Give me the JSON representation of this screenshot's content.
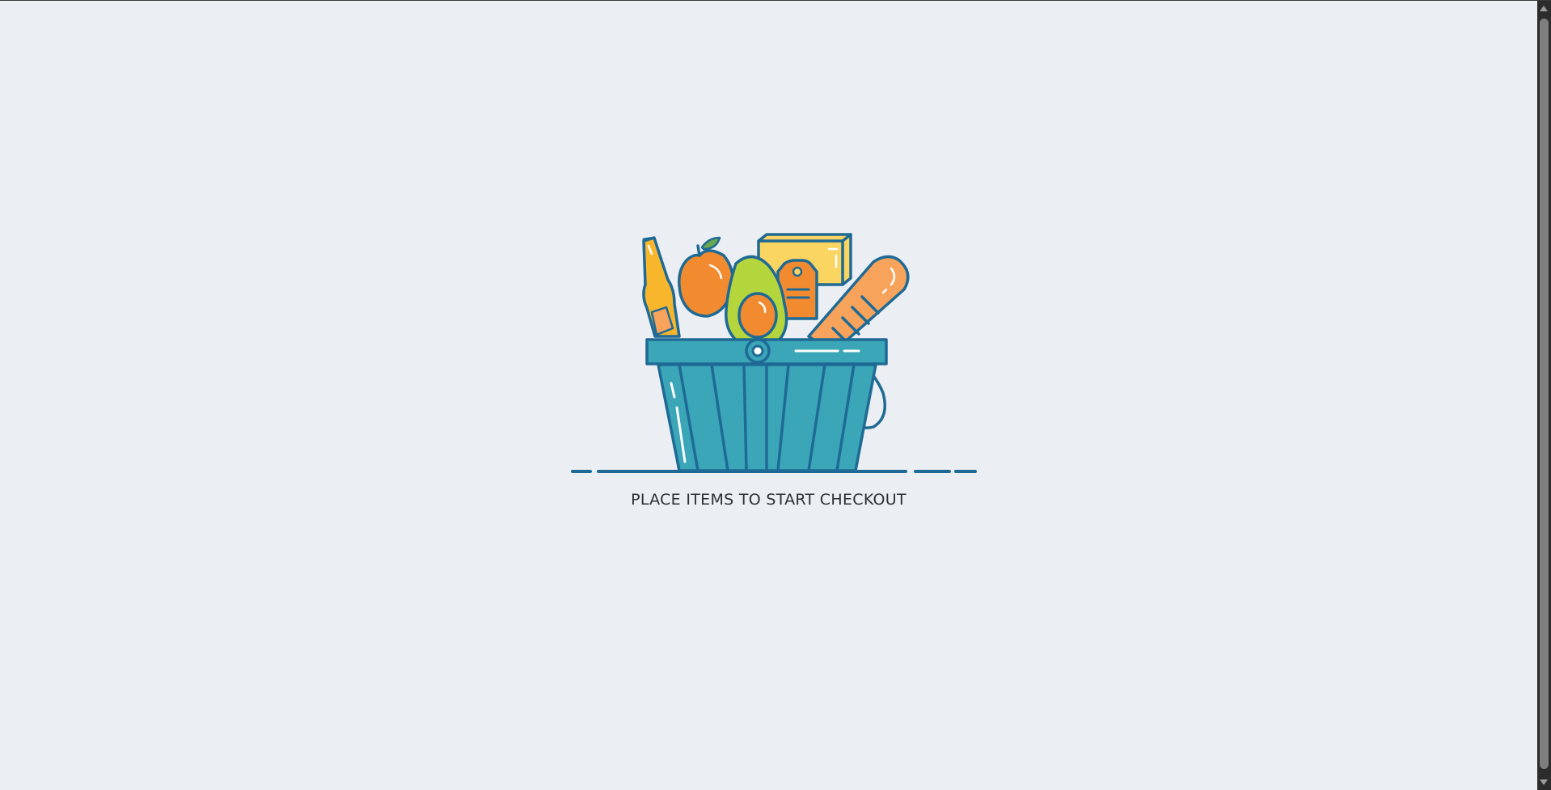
{
  "checkout": {
    "message": "PLACE ITEMS TO START CHECKOUT",
    "illustration": "grocery-basket-illustration"
  },
  "colors": {
    "background": "#ebeff3",
    "outline": "#1f6a95",
    "basket": "#3aa6b8",
    "orange": "#f28a30",
    "bread": "#f7a35c",
    "avocado": "#b5d53c",
    "bottle": "#f8b62d",
    "box": "#fbd562",
    "text": "#2b2f36"
  }
}
